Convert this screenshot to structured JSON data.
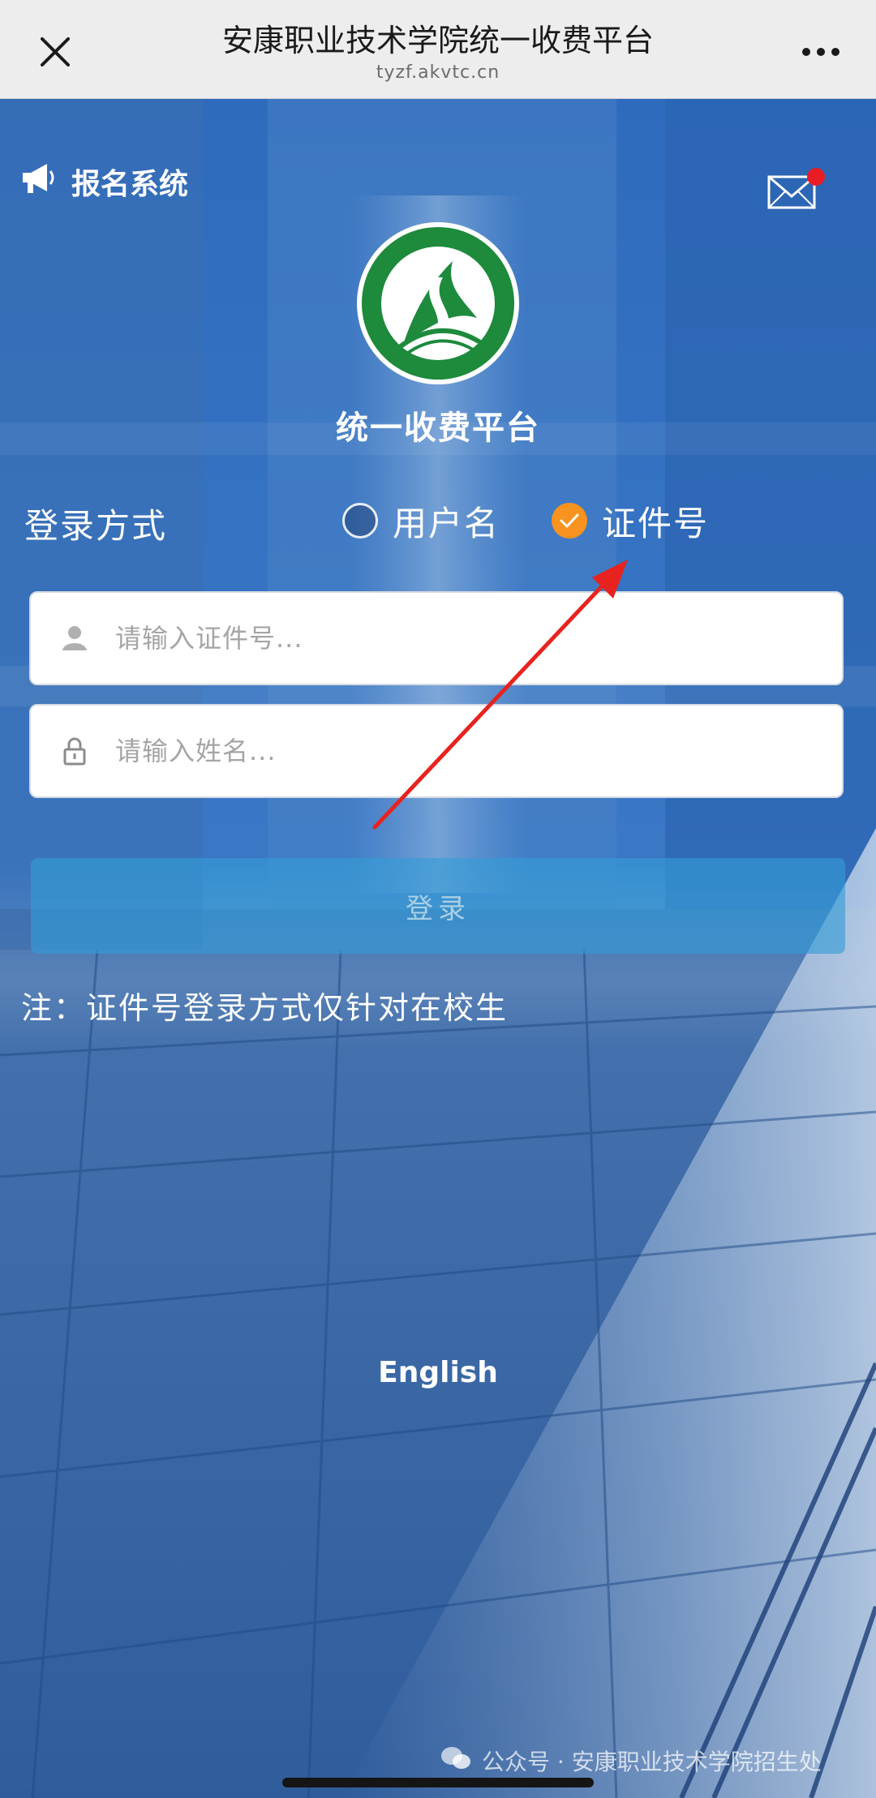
{
  "browser": {
    "title": "安康职业技术学院统一收费平台",
    "url": "tyzf.akvtc.cn",
    "close_icon": "close-icon",
    "more_icon": "more-dots-icon"
  },
  "header": {
    "registration_label": "报名系统",
    "registration_icon": "megaphone-icon",
    "mail_icon": "envelope-icon",
    "mail_has_notification": true
  },
  "logo": {
    "icon": "school-emblem-logo",
    "colors": {
      "primary": "#1d8a3c",
      "ring": "#ffffff"
    }
  },
  "platform": {
    "title": "统一收费平台"
  },
  "login_method": {
    "label": "登录方式",
    "options": [
      {
        "label": "用户名",
        "selected": false
      },
      {
        "label": "证件号",
        "selected": true
      }
    ]
  },
  "form": {
    "id_field": {
      "placeholder": "请输入证件号...",
      "value": "",
      "icon": "user-icon"
    },
    "name_field": {
      "placeholder": "请输入姓名...",
      "value": "",
      "icon": "lock-icon"
    },
    "submit_label": "登录"
  },
  "note": "注：证件号登录方式仅针对在校生",
  "language_link": "English",
  "watermark": "公众号 · 安康职业技术学院招生处",
  "colors": {
    "selected_radio": "#f7931e",
    "login_button": "#349cd6",
    "arrow": "#e8231f",
    "notification_dot": "#e81c24"
  }
}
